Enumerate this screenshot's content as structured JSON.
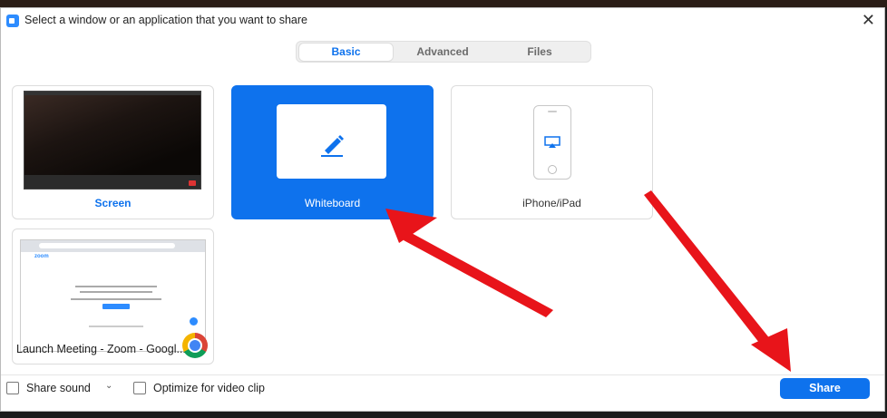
{
  "window": {
    "title": "Select a window or an application that you want to share"
  },
  "tabs": [
    {
      "label": "Basic",
      "active": true
    },
    {
      "label": "Advanced",
      "active": false
    },
    {
      "label": "Files",
      "active": false
    }
  ],
  "sources": [
    {
      "label": "Screen"
    },
    {
      "label": "Whiteboard",
      "selected": true
    },
    {
      "label": "iPhone/iPad"
    },
    {
      "label": "Launch Meeting - Zoom - Googl..."
    }
  ],
  "footer": {
    "share_sound": "Share sound",
    "optimize": "Optimize for video clip",
    "share_button": "Share"
  },
  "colors": {
    "accent": "#0e72ed",
    "annotation": "#e8141a"
  },
  "icons": [
    "zoom-logo-icon",
    "close-icon",
    "pen-icon",
    "airplay-icon",
    "chrome-icon",
    "chevron-down-icon"
  ]
}
